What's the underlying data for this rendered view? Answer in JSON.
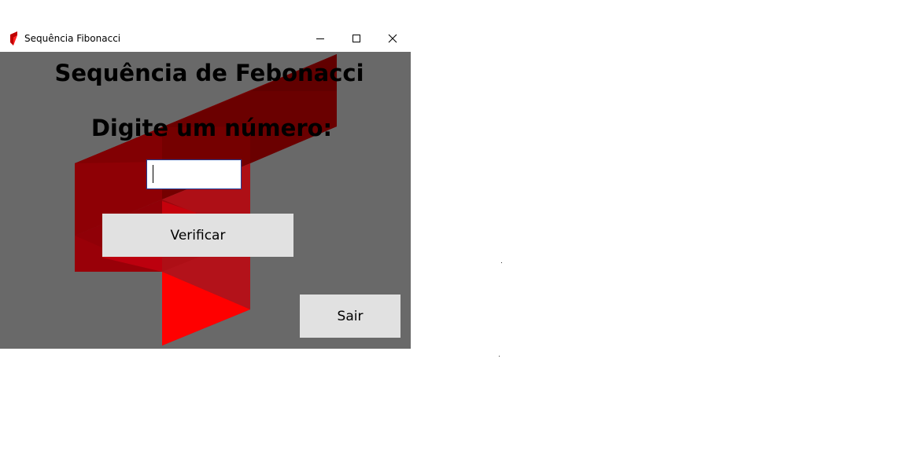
{
  "window": {
    "title": "Sequência Fibonacci",
    "icons": {
      "app": "app-logo-icon",
      "minimize": "minimize-icon",
      "maximize": "maximize-icon",
      "close": "close-icon"
    }
  },
  "form": {
    "heading": "Sequência de Febonacci",
    "prompt": "Digite um número:",
    "number_input_value": "",
    "verify_label": "Verificar",
    "exit_label": "Sair"
  },
  "colors": {
    "background": "#696969",
    "accent_red": "#ff0000",
    "dark_red": "#6a0000",
    "button": "#e1e1e1",
    "input_border": "#1f3f9a"
  }
}
